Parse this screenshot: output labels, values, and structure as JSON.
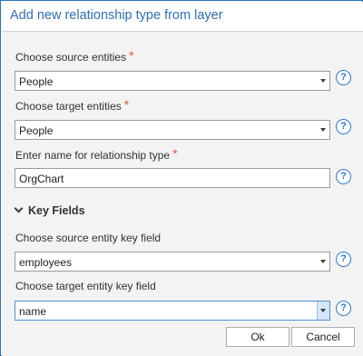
{
  "dialog": {
    "title": "Add new relationship type from layer"
  },
  "fields": {
    "source_entities": {
      "label": "Choose source entities",
      "required_mark": "*",
      "value": "People"
    },
    "target_entities": {
      "label": "Choose target entities",
      "required_mark": "*",
      "value": "People"
    },
    "relationship_name": {
      "label": "Enter name for relationship type",
      "required_mark": "*",
      "value": "OrgChart"
    }
  },
  "key_fields": {
    "header": "Key Fields",
    "source_key": {
      "label": "Choose source entity key field",
      "value": "employees"
    },
    "target_key": {
      "label": "Choose target entity key field",
      "value": "name"
    }
  },
  "help_icon_glyph": "?",
  "buttons": {
    "ok": "Ok",
    "cancel": "Cancel"
  },
  "colors": {
    "title": "#2e6fb5",
    "required": "#e0573d",
    "help": "#2e7ad1",
    "border": "#2f73b8"
  }
}
